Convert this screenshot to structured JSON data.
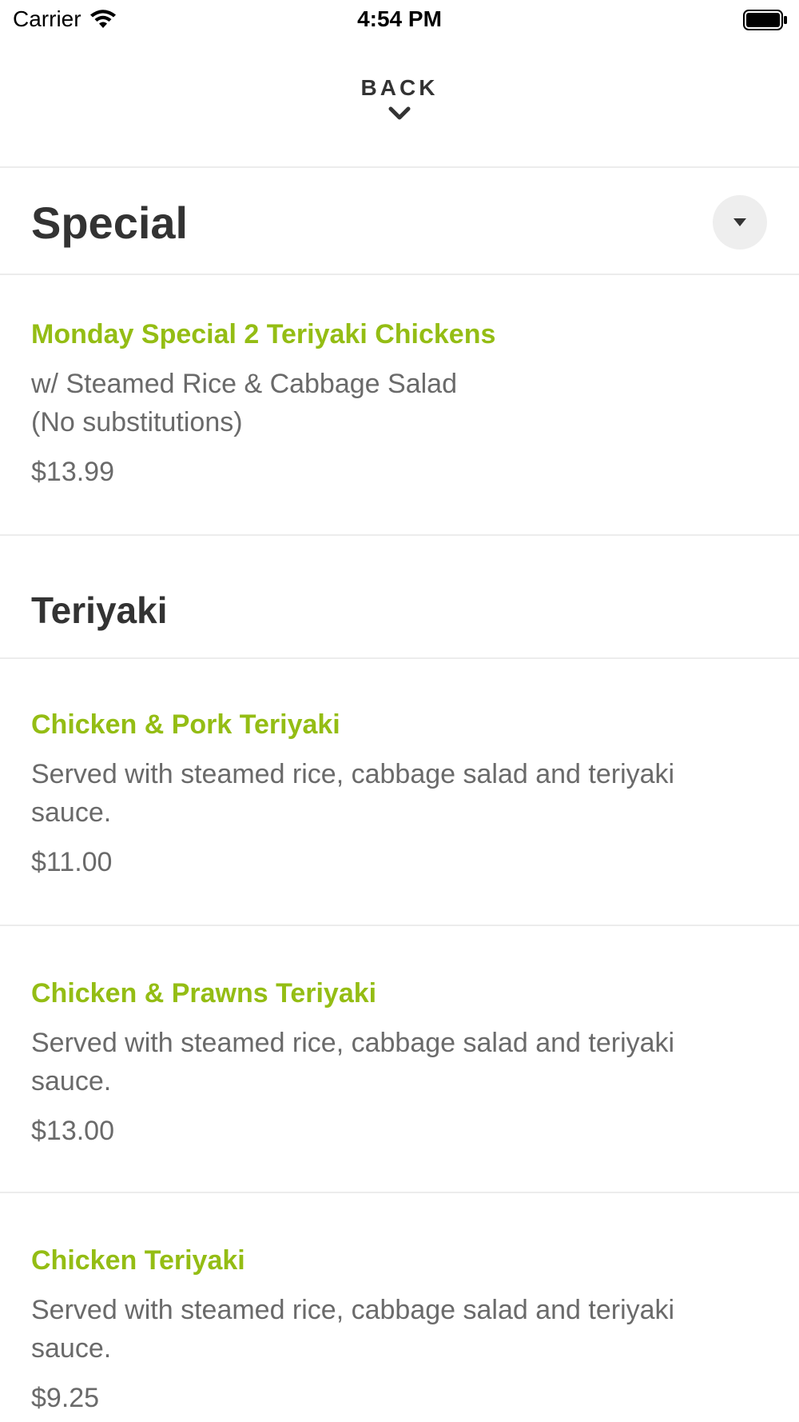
{
  "status_bar": {
    "carrier": "Carrier",
    "time": "4:54 PM"
  },
  "nav": {
    "back_label": "BACK"
  },
  "sections": [
    {
      "title": "Special",
      "items": [
        {
          "name": "Monday Special 2 Teriyaki Chickens",
          "description": "w/ Steamed Rice & Cabbage Salad\n(No substitutions)",
          "price": "$13.99"
        }
      ]
    },
    {
      "title": "Teriyaki",
      "items": [
        {
          "name": "Chicken & Pork Teriyaki",
          "description": "Served with steamed rice, cabbage salad and teriyaki sauce.",
          "price": "$11.00"
        },
        {
          "name": "Chicken & Prawns Teriyaki",
          "description": "Served with steamed rice, cabbage salad and teriyaki sauce.",
          "price": "$13.00"
        },
        {
          "name": "Chicken Teriyaki",
          "description": "Served with steamed rice, cabbage salad and teriyaki sauce.",
          "price": "$9.25"
        }
      ]
    }
  ],
  "colors": {
    "item_name": "#94bd14",
    "text_secondary": "#6a6a6a",
    "heading": "#333333",
    "divider": "#ececec"
  }
}
